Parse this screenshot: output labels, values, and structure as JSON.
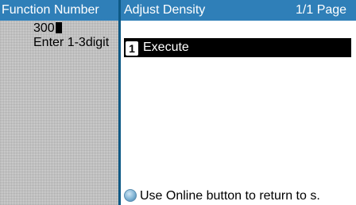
{
  "left_panel": {
    "header": "Function Number",
    "value": "300",
    "hint": "Enter 1-3digit"
  },
  "right_panel": {
    "title": "Adjust Density",
    "page_indicator": "1/1 Page",
    "menu_items": [
      {
        "number": "1",
        "label": "Execute",
        "selected": true
      }
    ]
  },
  "status": {
    "icon": "online-button-icon",
    "message": "Use Online button to return to s."
  },
  "colors": {
    "header_bg": "#2f7fb8",
    "panel_divider": "#0e5a86",
    "selected_bg": "#000000"
  }
}
